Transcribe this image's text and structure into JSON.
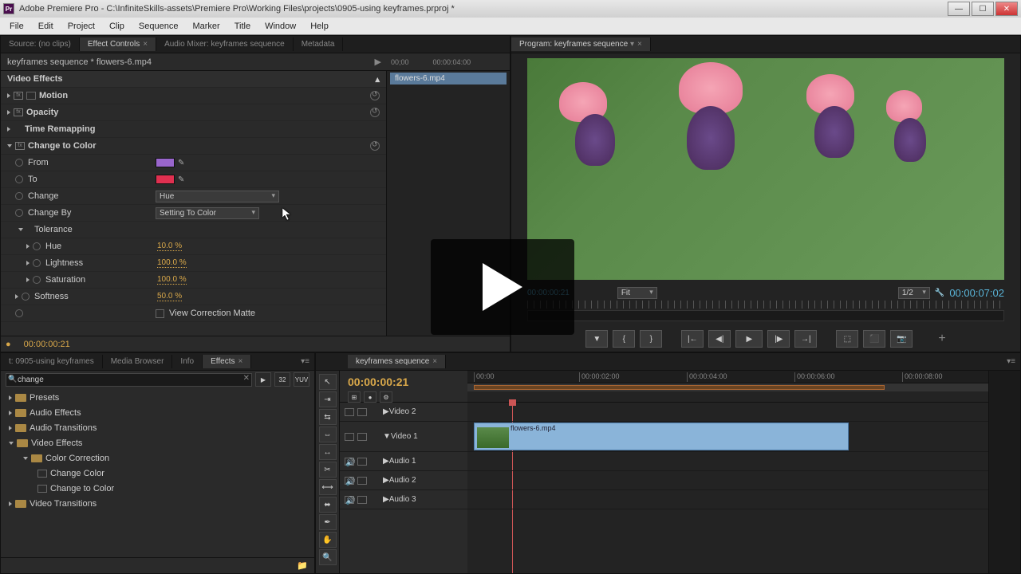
{
  "titlebar": {
    "app": "Pr",
    "title": "Adobe Premiere Pro - C:\\InfiniteSkills-assets\\Premiere Pro\\Working Files\\projects\\0905-using keyframes.prproj *"
  },
  "menu": [
    "File",
    "Edit",
    "Project",
    "Clip",
    "Sequence",
    "Marker",
    "Title",
    "Window",
    "Help"
  ],
  "source_tabs": {
    "source": "Source: (no clips)",
    "effect_controls": "Effect Controls",
    "audio_mixer": "Audio Mixer: keyframes sequence",
    "metadata": "Metadata"
  },
  "ec": {
    "seq_clip": "keyframes sequence * flowers-6.mp4",
    "time_end": "00:00:04:00",
    "clipname": "flowers-6.mp4",
    "video_effects": "Video Effects",
    "motion": "Motion",
    "opacity": "Opacity",
    "time_remapping": "Time Remapping",
    "change_to_color": "Change to Color",
    "from": "From",
    "to": "To",
    "change": "Change",
    "change_val": "Hue",
    "change_by": "Change By",
    "change_by_val": "Setting To Color",
    "tolerance": "Tolerance",
    "hue": "Hue",
    "hue_val": "10.0 %",
    "lightness": "Lightness",
    "lightness_val": "100.0 %",
    "saturation": "Saturation",
    "saturation_val": "100.0 %",
    "softness": "Softness",
    "softness_val": "50.0 %",
    "view_matte": "View Correction Matte",
    "from_color": "#9966cc",
    "to_color": "#e03050",
    "footer_tc": "00:00:00:21"
  },
  "program": {
    "tab": "Program: keyframes sequence",
    "tc_left": "00:00:00:21",
    "fit": "Fit",
    "zoom": "1/2",
    "tc_right": "00:00:07:02"
  },
  "project_tabs": {
    "project": "t: 0905-using keyframes",
    "media_browser": "Media Browser",
    "info": "Info",
    "effects": "Effects"
  },
  "effects_panel": {
    "search": "change",
    "presets": "Presets",
    "audio_effects": "Audio Effects",
    "audio_transitions": "Audio Transitions",
    "video_effects": "Video Effects",
    "color_correction": "Color Correction",
    "change_color": "Change Color",
    "change_to_color": "Change to Color",
    "video_transitions": "Video Transitions"
  },
  "timeline": {
    "tab": "keyframes sequence",
    "tc": "00:00:00:21",
    "ticks": [
      "00:00",
      "00:00:02:00",
      "00:00:04:00",
      "00:00:06:00",
      "00:00:08:00"
    ],
    "video2": "Video 2",
    "video1": "Video 1",
    "audio1": "Audio 1",
    "audio2": "Audio 2",
    "audio3": "Audio 3",
    "clip": "flowers-6.mp4"
  }
}
